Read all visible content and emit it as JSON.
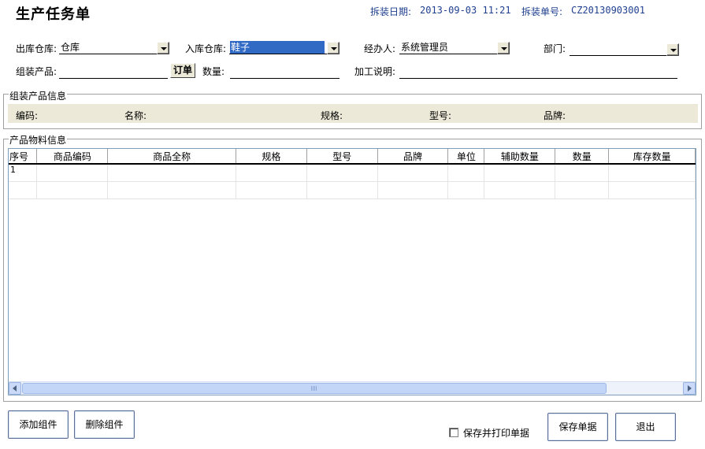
{
  "window": {
    "title": "生产任务单",
    "date_label": "拆装日期:",
    "date_value": "2013-09-03 11:21",
    "order_no_label": "拆装单号:",
    "order_no_value": "CZ20130903001"
  },
  "form": {
    "out_warehouse": {
      "label": "出库仓库:",
      "value": "仓库"
    },
    "in_warehouse": {
      "label": "入库仓库:",
      "value": "鞋子"
    },
    "handler": {
      "label": "经办人:",
      "value": "系统管理员"
    },
    "department": {
      "label": "部门:",
      "value": ""
    },
    "assembly_product": {
      "label": "组装产品:",
      "value": ""
    },
    "order_button": "订单",
    "quantity": {
      "label": "数量:",
      "value": ""
    },
    "process_note": {
      "label": "加工说明:",
      "value": ""
    }
  },
  "product_info": {
    "legend": "组装产品信息",
    "fields": [
      {
        "label": "编码:",
        "value": ""
      },
      {
        "label": "名称:",
        "value": ""
      },
      {
        "label": "规格:",
        "value": ""
      },
      {
        "label": "型号:",
        "value": ""
      },
      {
        "label": "品牌:",
        "value": ""
      }
    ]
  },
  "materials": {
    "legend": "产品物料信息",
    "columns": [
      "序号",
      "商品编码",
      "商品全称",
      "规格",
      "型号",
      "品牌",
      "单位",
      "辅助数量",
      "数量",
      "库存数量"
    ],
    "rows": [
      [
        "1",
        "",
        "",
        "",
        "",
        "",
        "",
        "",
        "",
        ""
      ],
      [
        "",
        "",
        "",
        "",
        "",
        "",
        "",
        "",
        "",
        ""
      ]
    ]
  },
  "buttons": {
    "add_component": "添加组件",
    "delete_component": "删除组件",
    "save_print_label": "保存并打印单据",
    "save_print_checked": false,
    "save": "保存单据",
    "exit": "退出"
  },
  "colors": {
    "header_text": "#1f3f8f",
    "info_bar": "#ece9d8",
    "selection": "#316ac5"
  }
}
